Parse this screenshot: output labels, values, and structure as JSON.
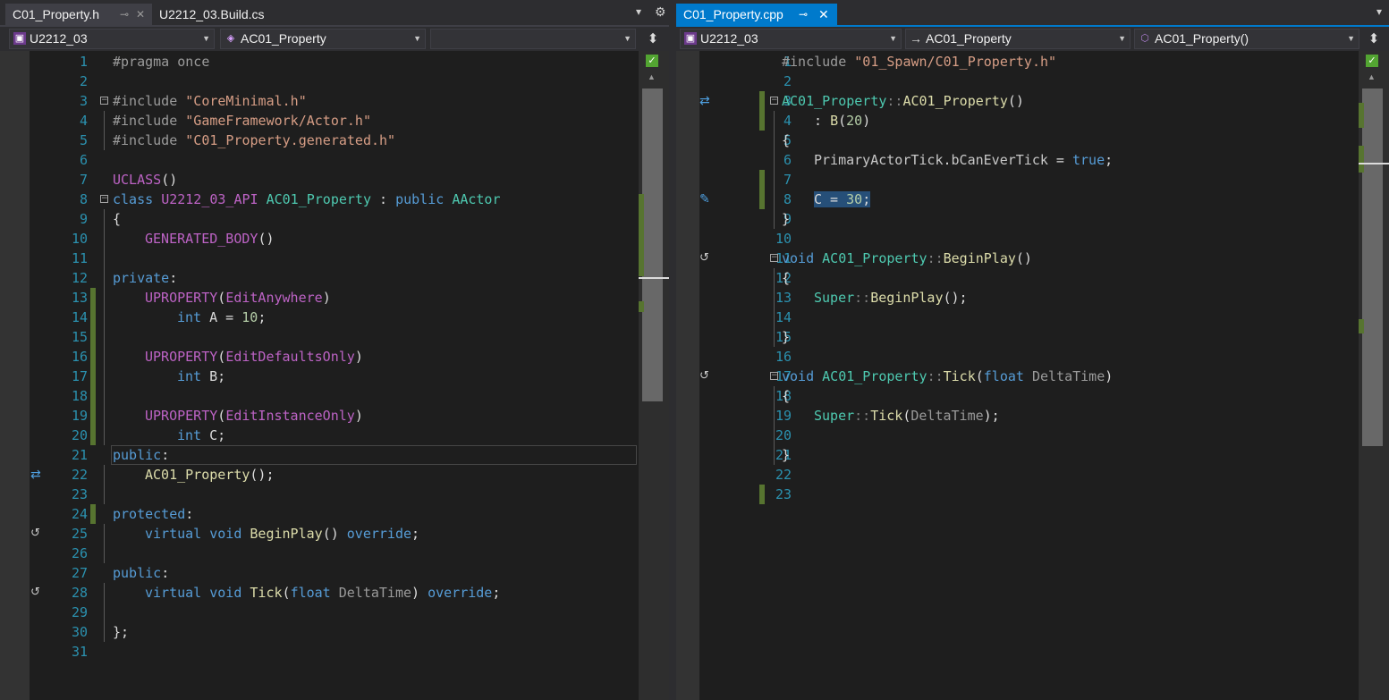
{
  "left": {
    "tabs": [
      {
        "label": "C01_Property.h",
        "pin": "⊸",
        "close": "✕"
      },
      {
        "label": "U2212_03.Build.cs"
      }
    ],
    "strip_icons": {
      "dropdown": "▾",
      "settings": "⚙"
    },
    "nav": {
      "project": "U2212_03",
      "scope": "AC01_Property",
      "member": "",
      "split": "⬍"
    },
    "check": "✓"
  },
  "right": {
    "tabs": [
      {
        "label": "C01_Property.cpp",
        "pin": "⊸",
        "close": "✕"
      }
    ],
    "strip_icons": {
      "dropdown": "▾"
    },
    "nav": {
      "project": "U2212_03",
      "scope": "AC01_Property",
      "member": "AC01_Property()",
      "split": "⬍"
    },
    "check": "✓"
  },
  "header_code": [
    {
      "n": "1",
      "t": "#pragma once"
    },
    {
      "n": "2",
      "t": ""
    },
    {
      "n": "3",
      "t": "#include \"CoreMinimal.h\""
    },
    {
      "n": "4",
      "t": "#include \"GameFramework/Actor.h\""
    },
    {
      "n": "5",
      "t": "#include \"C01_Property.generated.h\""
    },
    {
      "n": "6",
      "t": ""
    },
    {
      "n": "7",
      "t": "UCLASS()"
    },
    {
      "n": "8",
      "t": "class U2212_03_API AC01_Property : public AActor"
    },
    {
      "n": "9",
      "t": "{"
    },
    {
      "n": "10",
      "t": "GENERATED_BODY()"
    },
    {
      "n": "11",
      "t": ""
    },
    {
      "n": "12",
      "t": "private:"
    },
    {
      "n": "13",
      "t": "UPROPERTY(EditAnywhere)"
    },
    {
      "n": "14",
      "t": "int A = 10;"
    },
    {
      "n": "15",
      "t": ""
    },
    {
      "n": "16",
      "t": "UPROPERTY(EditDefaultsOnly)"
    },
    {
      "n": "17",
      "t": "int B;"
    },
    {
      "n": "18",
      "t": ""
    },
    {
      "n": "19",
      "t": "UPROPERTY(EditInstanceOnly)"
    },
    {
      "n": "20",
      "t": "int C;"
    },
    {
      "n": "21",
      "t": "public:"
    },
    {
      "n": "22",
      "t": "AC01_Property();"
    },
    {
      "n": "23",
      "t": ""
    },
    {
      "n": "24",
      "t": "protected:"
    },
    {
      "n": "25",
      "t": "virtual void BeginPlay() override;"
    },
    {
      "n": "26",
      "t": ""
    },
    {
      "n": "27",
      "t": "public:"
    },
    {
      "n": "28",
      "t": "virtual void Tick(float DeltaTime) override;"
    },
    {
      "n": "29",
      "t": ""
    },
    {
      "n": "30",
      "t": "};"
    },
    {
      "n": "31",
      "t": ""
    }
  ],
  "source_code": [
    {
      "n": "1",
      "t": "#include \"01_Spawn/C01_Property.h\""
    },
    {
      "n": "2",
      "t": ""
    },
    {
      "n": "3",
      "t": "AC01_Property::AC01_Property()"
    },
    {
      "n": "4",
      "t": ": B(20)"
    },
    {
      "n": "5",
      "t": "{"
    },
    {
      "n": "6",
      "t": "PrimaryActorTick.bCanEverTick = true;"
    },
    {
      "n": "7",
      "t": ""
    },
    {
      "n": "8",
      "t": "C = 30;"
    },
    {
      "n": "9",
      "t": "}"
    },
    {
      "n": "10",
      "t": ""
    },
    {
      "n": "11",
      "t": "void AC01_Property::BeginPlay()"
    },
    {
      "n": "12",
      "t": "{"
    },
    {
      "n": "13",
      "t": "Super::BeginPlay();"
    },
    {
      "n": "14",
      "t": ""
    },
    {
      "n": "15",
      "t": "}"
    },
    {
      "n": "16",
      "t": ""
    },
    {
      "n": "17",
      "t": "void AC01_Property::Tick(float DeltaTime)"
    },
    {
      "n": "18",
      "t": "{"
    },
    {
      "n": "19",
      "t": "Super::Tick(DeltaTime);"
    },
    {
      "n": "20",
      "t": ""
    },
    {
      "n": "21",
      "t": "}"
    },
    {
      "n": "22",
      "t": ""
    },
    {
      "n": "23",
      "t": ""
    }
  ]
}
